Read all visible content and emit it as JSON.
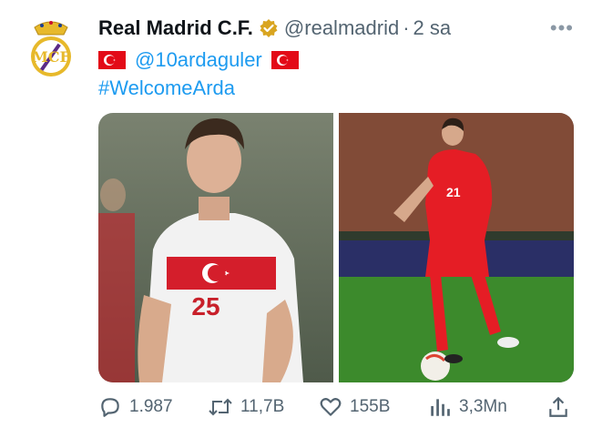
{
  "tweet": {
    "author_name": "Real Madrid C.F.",
    "handle": "@realmadrid",
    "separator": "·",
    "time": "2 sa",
    "more": "•••",
    "mention": "@10ardaguler",
    "hashtag": "#WelcomeArda",
    "shirt_number_left": "25",
    "shirt_number_right": "21"
  },
  "actions": {
    "replies": "1.987",
    "retweets": "11,7B",
    "likes": "155B",
    "views": "3,3Mn"
  },
  "colors": {
    "link": "#1d9bf0",
    "muted": "#536471",
    "flag_red": "#e30a17",
    "verified_gold": "#d9a520"
  },
  "icons": [
    "crest-icon",
    "verified-badge-icon",
    "more-icon",
    "turkey-flag-icon",
    "reply-icon",
    "retweet-icon",
    "like-icon",
    "views-icon",
    "share-icon"
  ]
}
